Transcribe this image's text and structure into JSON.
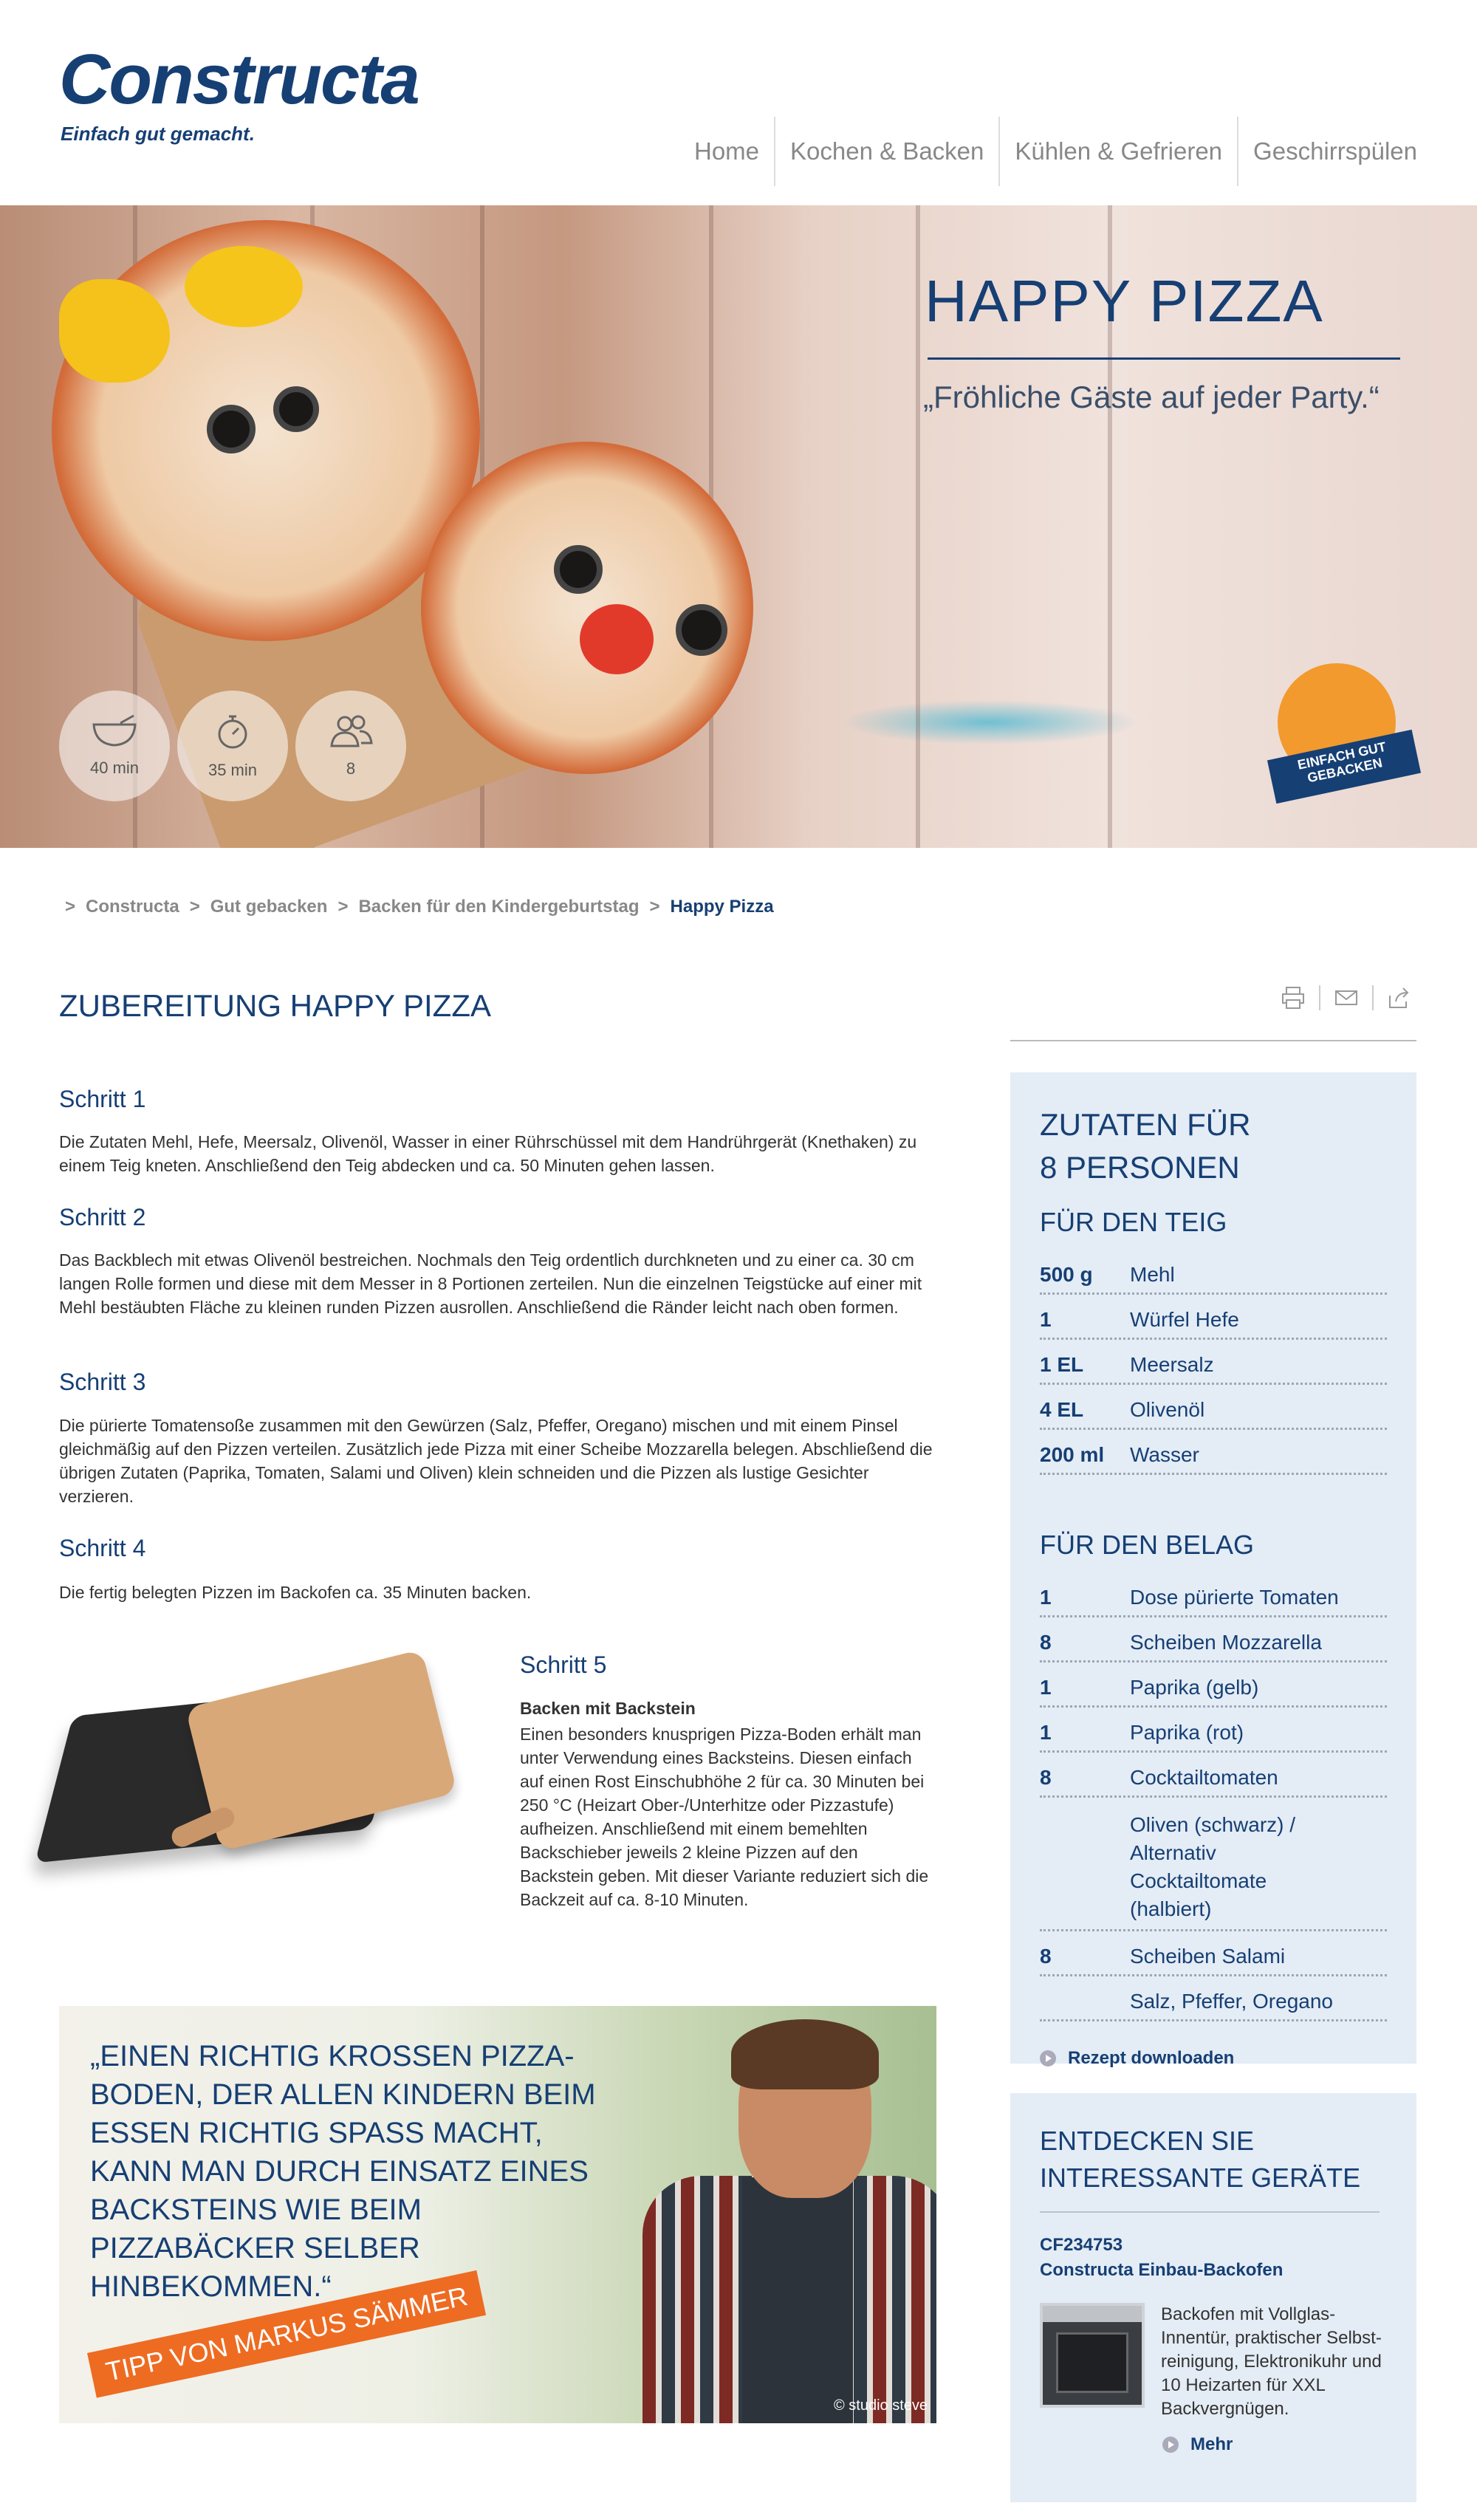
{
  "brand": {
    "name": "Constructa",
    "tagline": "Einfach gut gemacht."
  },
  "nav": [
    "Home",
    "Kochen & Backen",
    "Kühlen & Gefrieren",
    "Geschirrspülen"
  ],
  "hero": {
    "title": "HAPPY PIZZA",
    "quote": "„Fröhliche Gäste auf jeder Party.“",
    "stats": [
      {
        "icon": "mixing-bowl-icon",
        "label": "40 min"
      },
      {
        "icon": "stopwatch-icon",
        "label": "35 min"
      },
      {
        "icon": "persons-icon",
        "label": "8"
      }
    ],
    "badge": "EINFACH GUT GEBACKEN"
  },
  "breadcrumb": [
    ">",
    "Constructa",
    ">",
    "Gut gebacken",
    ">",
    "Backen für den Kindergeburtstag",
    ">",
    "Happy Pizza"
  ],
  "main": {
    "title": "ZUBEREITUNG HAPPY PIZZA",
    "steps": [
      {
        "title": "Schritt 1",
        "text": "Die Zutaten Mehl, Hefe, Meersalz, Olivenöl, Wasser in einer Rührschüssel mit dem Handrührgerät (Knethaken) zu einem Teig kneten. Anschließend den Teig abdecken und ca. 50 Minuten gehen lassen."
      },
      {
        "title": "Schritt 2",
        "text": "Das Backblech mit etwas Olivenöl bestreichen. Nochmals den Teig ordentlich durchkneten und zu einer ca. 30 cm langen Rolle formen und diese mit dem Messer in 8 Portionen zerteilen. Nun die einzelnen Teigstücke auf einer mit Mehl bestäubten Fläche zu kleinen runden Pizzen ausrollen. Anschließend die Ränder leicht nach oben formen."
      },
      {
        "title": "Schritt 3",
        "text": "Die pürierte Tomatensoße zusammen mit den Gewürzen (Salz, Pfeffer, Oregano) mischen und mit einem Pinsel gleichmäßig auf den Pizzen verteilen. Zusätzlich jede Pizza mit einer Scheibe Mozzarella belegen. Abschließend die übrigen Zutaten (Paprika, Tomaten, Salami und Oliven) klein schneiden und die Pizzen als lustige Gesichter verzieren."
      },
      {
        "title": "Schritt 4",
        "text": "Die fertig belegten Pizzen im Backofen ca. 35 Minuten backen."
      }
    ],
    "step5": {
      "title": "Schritt 5",
      "subtitle": "Backen mit Backstein",
      "text": "Einen besonders knusprigen Pizza-Boden erhält man unter Verwendung eines Backsteins. Diesen einfach auf einen Rost Einschubhöhe 2 für ca. 30 Minuten bei 250 °C (Heizart Ober-/Unterhitze oder Pizzastufe) aufheizen. Anschließend mit einem bemehlten Backschieber jeweils 2 kleine Pizzen auf den Backstein geben. Mit dieser Variante reduziert sich die Backzeit auf ca. 8-10 Minuten."
    }
  },
  "quote_banner": {
    "quote": "„EINEN RICHTIG KROSSEN PIZZA-BODEN, DER ALLEN KINDERN BEIM ESSEN RICHTIG SPASS MACHT, KANN MAN DURCH EINSATZ EINES BACKSTEINS WIE BEIM PIZZABÄCKER SELBER HINBEKOMMEN.“",
    "tip": "TIPP VON MARKUS SÄMMER",
    "credit": "© studio steve"
  },
  "ingredients": {
    "title_line1": "ZUTATEN FÜR",
    "title_line2": "8 PERSONEN",
    "dough_title": "FÜR DEN TEIG",
    "dough": [
      {
        "q": "500 g",
        "n": "Mehl"
      },
      {
        "q": "1",
        "n": "Würfel Hefe"
      },
      {
        "q": "1 EL",
        "n": "Meersalz"
      },
      {
        "q": "4 EL",
        "n": "Olivenöl"
      },
      {
        "q": "200 ml",
        "n": "Wasser"
      }
    ],
    "topping_title": "FÜR DEN BELAG",
    "topping": [
      {
        "q": "1",
        "n": "Dose pürierte Tomaten"
      },
      {
        "q": "8",
        "n": "Scheiben Mozzarella"
      },
      {
        "q": "1",
        "n": "Paprika (gelb)"
      },
      {
        "q": "1",
        "n": "Paprika (rot)"
      },
      {
        "q": "8",
        "n": "Cocktailtomaten"
      },
      {
        "q": "",
        "n": "Oliven (schwarz) / Alternativ Cocktailtomate (halbiert)"
      },
      {
        "q": "8",
        "n": "Scheiben Salami"
      },
      {
        "q": "",
        "n": "Salz, Pfeffer, Oregano"
      }
    ],
    "download": "Rezept downloaden"
  },
  "devices": {
    "title": "ENTDECKEN SIE INTERESSANTE GERÄTE",
    "model": "CF234753",
    "name": "Constructa Einbau-Backofen",
    "desc": "Backofen mit Vollglas-Innentür, praktischer Selbst-reinigung, Elektronikuhr und 10 Heizarten für XXL Backvergnügen.",
    "more": "Mehr"
  },
  "colors": {
    "brand": "#163f74",
    "accent": "#ee6b22",
    "sidebar_bg": "#e4ecf5"
  }
}
